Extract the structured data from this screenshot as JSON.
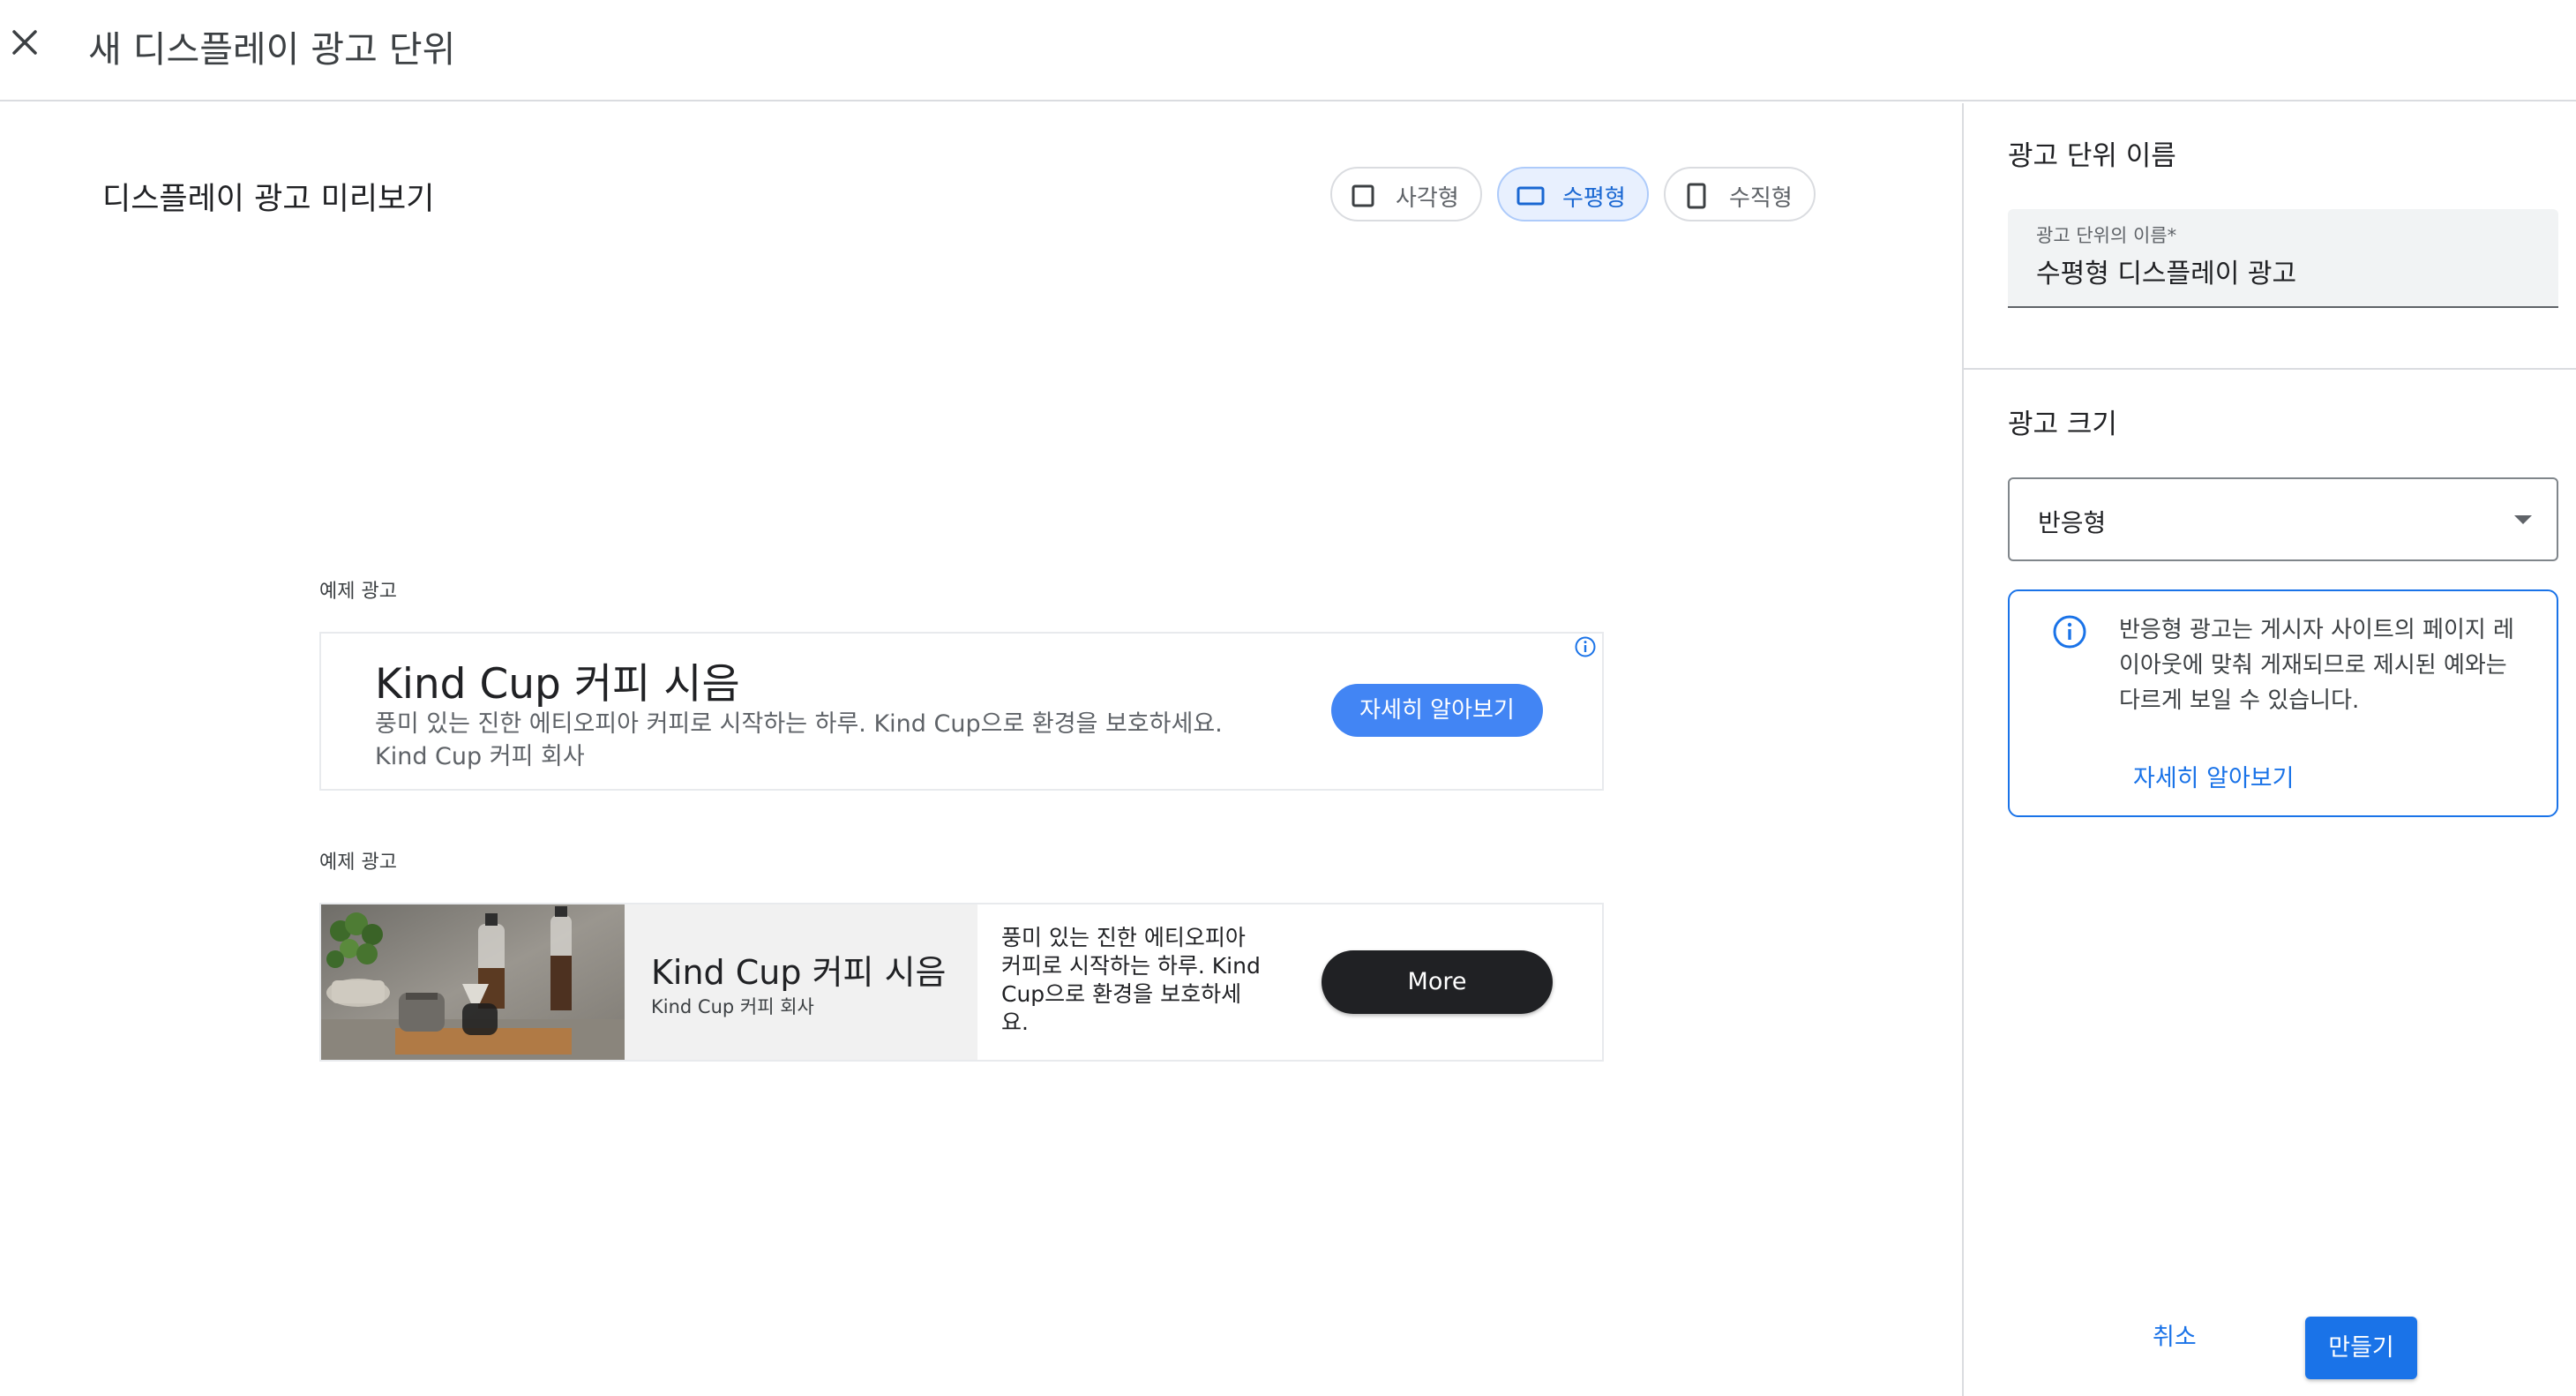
{
  "header": {
    "title": "새 디스플레이 광고 단위",
    "close_icon": "close-icon"
  },
  "preview": {
    "title": "디스플레이 광고 미리보기",
    "chips": [
      {
        "label": "사각형",
        "icon": "square-icon",
        "selected": false
      },
      {
        "label": "수평형",
        "icon": "horizontal-rect-icon",
        "selected": true
      },
      {
        "label": "수직형",
        "icon": "vertical-rect-icon",
        "selected": false
      }
    ],
    "sample_label_1": "예제 광고",
    "sample_label_2": "예제 광고",
    "ad1": {
      "headline": "Kind Cup 커피 시음",
      "body": "풍미 있는 진한 에티오피아 커피로 시작하는 하루. Kind Cup으로 환경을 보호하세요. Kind Cup 커피 회사",
      "cta": "자세히 알아보기",
      "info_icon": "adchoices-info-icon"
    },
    "ad2": {
      "headline": "Kind Cup 커피 시음",
      "advertiser": "Kind Cup 커피 회사",
      "description": "풍미 있는 진한 에티오피아 커피로 시작하는 하루. Kind Cup으로 환경을 보호하세요.",
      "button": "More",
      "image": "coffee-pour-over-photo"
    }
  },
  "sidebar": {
    "name_section_title": "광고 단위 이름",
    "name_field_label": "광고 단위의 이름*",
    "name_field_value": "수평형 디스플레이 광고",
    "size_section_title": "광고 크기",
    "size_select_value": "반응형",
    "info_text": "반응형 광고는 게시자 사이트의 페이지 레이아웃에 맞춰 게재되므로 제시된 예와는 다르게 보일 수 있습니다.",
    "info_link": "자세히 알아보기",
    "info_icon": "info-icon"
  },
  "footer": {
    "cancel": "취소",
    "create": "만들기"
  },
  "colors": {
    "accent": "#1a73e8",
    "ad_cta": "#4285f4",
    "chip_selected_bg": "#e8f0fe",
    "dark_button": "#202124"
  }
}
